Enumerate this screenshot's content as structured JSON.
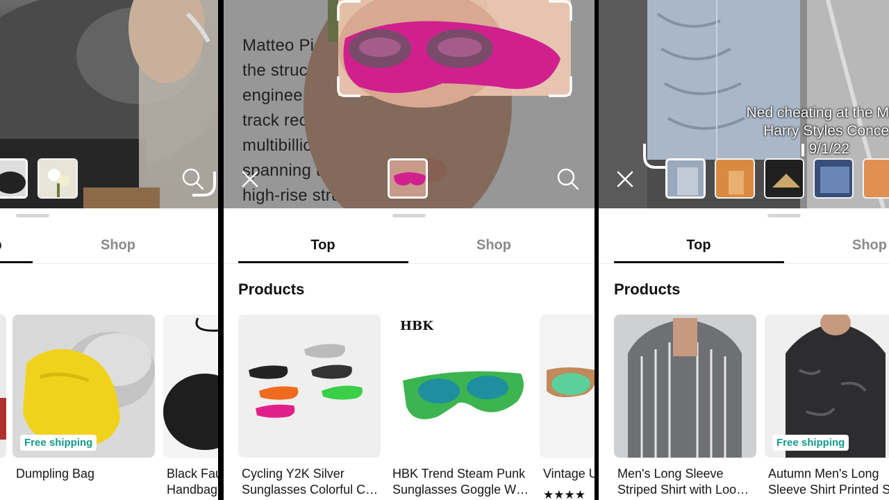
{
  "panels": [
    {
      "tabs": [
        {
          "label": "Top"
        },
        {
          "label": "Shop"
        }
      ],
      "products": [
        {
          "title": "Dumpling Bag",
          "badge": "Free shipping"
        },
        {
          "title": "Black Fau\nHandbag",
          "badge": ""
        }
      ]
    },
    {
      "video_text": [
        "Matteo Piet",
        "the structura",
        "engineering",
        "track record ex",
        "multibillion-dol           ects",
        "spanning transp                    and",
        "high-rise struct                 ded the"
      ],
      "tabs": [
        {
          "label": "Top"
        },
        {
          "label": "Shop"
        }
      ],
      "section_title": "Products",
      "products": [
        {
          "title": "Cycling Y2K Silver\nSunglasses Colorful C…",
          "badge": ""
        },
        {
          "title": "HBK Trend Steam Punk\nSunglasses Goggle W…",
          "badge": "",
          "brand": "HBK"
        },
        {
          "title": "Vintage U",
          "badge": "",
          "rating": "★★★★"
        }
      ]
    },
    {
      "caption": [
        "Ned cheating at the M",
        "Harry Styles Conce",
        "9/1/22"
      ],
      "tabs": [
        {
          "label": "Top"
        },
        {
          "label": "Shop"
        }
      ],
      "section_title": "Products",
      "products": [
        {
          "title": "Men's Long Sleeve\nStriped Shirt with Loo…",
          "badge": ""
        },
        {
          "title": "Autumn Men's Long\nSleeve Shirt Printed S",
          "badge": "Free shipping"
        }
      ]
    }
  ],
  "icons": {
    "search": "search-icon",
    "close": "close-icon"
  },
  "colors": {
    "badge_text": "#12998a",
    "glasses_pink": "#d0208e",
    "accent_underline": "#111111"
  }
}
